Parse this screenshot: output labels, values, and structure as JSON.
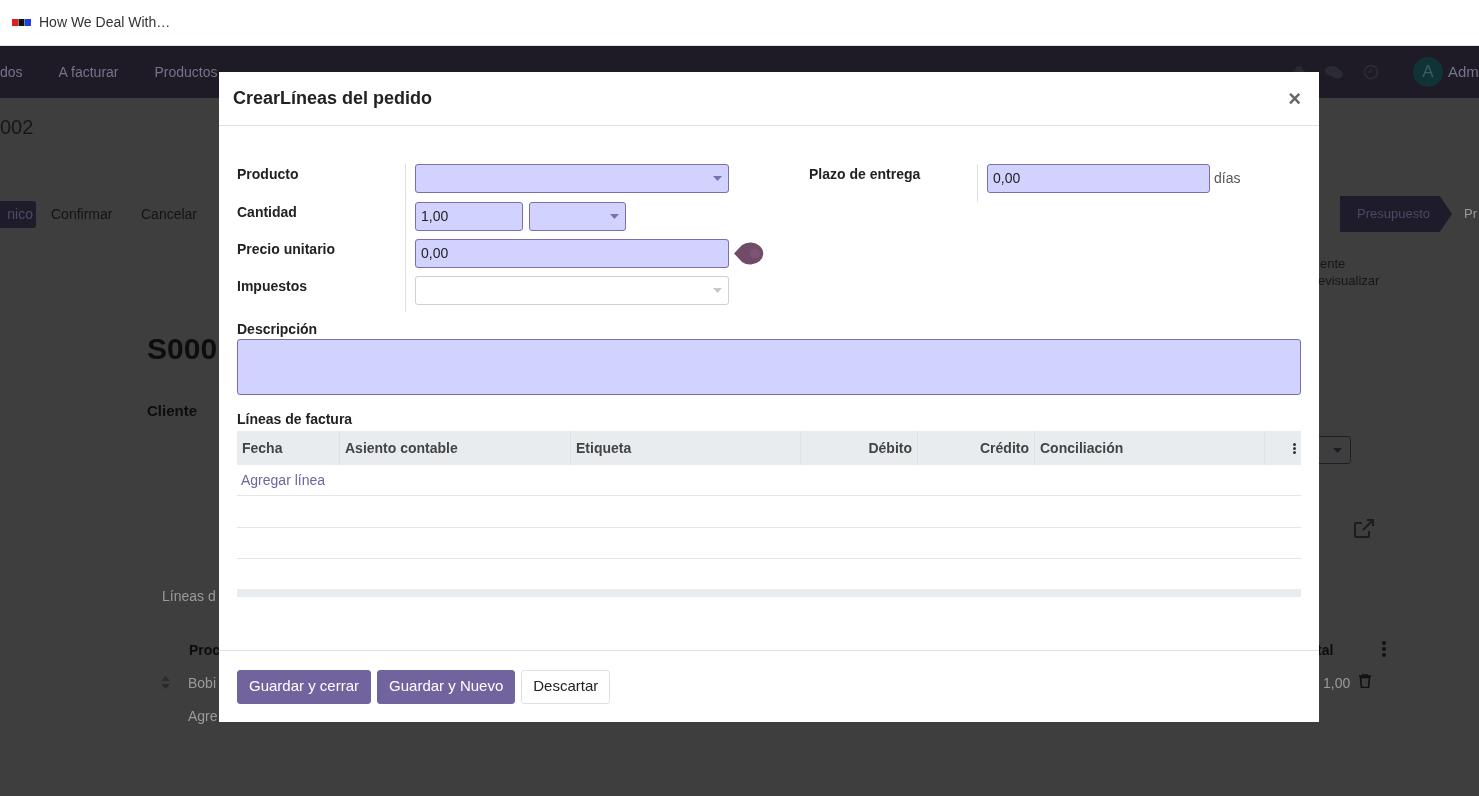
{
  "browser_tab": {
    "title": "How We Deal With…"
  },
  "navbar": {
    "items": [
      "dos",
      "A facturar",
      "Productos"
    ],
    "avatar": "A",
    "user": "Adm"
  },
  "background": {
    "breadcrumb": "002",
    "buttons": [
      {
        "label": "nico",
        "kind": "primary"
      },
      {
        "label": "Confirmar",
        "kind": "plain"
      },
      {
        "label": "Cancelar",
        "kind": "plain"
      }
    ],
    "stages": [
      {
        "label": "Presupuesto",
        "selected": true
      },
      {
        "label": "Pr",
        "selected": false
      }
    ],
    "smart_button_lines": [
      "ente",
      "evisualizar"
    ],
    "record_name": "S000",
    "field_label": "Cliente",
    "tab_label": "Líneas d",
    "lines_header": {
      "column_1": "Proc",
      "column_2": "tal"
    },
    "line": {
      "product": "Bobi",
      "amount": "1,00"
    },
    "add_line": "Agre"
  },
  "dialog": {
    "title": "CrearLíneas del pedido",
    "close": "×",
    "left_fields": [
      {
        "label": "Producto",
        "kind": "select",
        "required": true
      },
      {
        "label": "Cantidad",
        "kind": "quantity",
        "value": "1,00",
        "required": true
      },
      {
        "label": "Precio unitario",
        "kind": "number",
        "value": "0,00",
        "required": true
      },
      {
        "label": "Impuestos",
        "kind": "select",
        "required": false
      }
    ],
    "right_fields": [
      {
        "label": "Plazo de entrega",
        "value": "0,00",
        "suffix": "días",
        "required": true
      }
    ],
    "description": {
      "label": "Descripción",
      "required": true
    },
    "table": {
      "title": "Líneas de factura",
      "columns": [
        "Fecha",
        "Asiento contable",
        "Etiqueta",
        "Débito",
        "Crédito",
        "Conciliación"
      ],
      "add_line": "Agregar línea"
    },
    "buttons": [
      {
        "label": "Guardar y cerrar",
        "kind": "primary"
      },
      {
        "label": "Guardar y Nuevo",
        "kind": "primary"
      },
      {
        "label": "Descartar",
        "kind": "secondary"
      }
    ]
  }
}
